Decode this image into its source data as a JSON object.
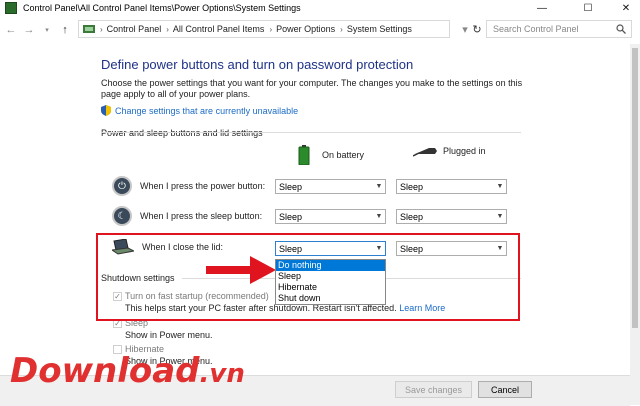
{
  "window": {
    "title": "Control Panel\\All Control Panel Items\\Power Options\\System Settings",
    "controls": {
      "minimize": "—",
      "maximize": "☐",
      "close": "✕"
    }
  },
  "address_bar": {
    "crumbs": [
      "Control Panel",
      "All Control Panel Items",
      "Power Options",
      "System Settings"
    ],
    "search_placeholder": "Search Control Panel"
  },
  "page": {
    "heading": "Define power buttons and turn on password protection",
    "description": "Choose the power settings that you want for your computer. The changes you make to the settings on this page apply to all of your power plans.",
    "change_link": "Change settings that are currently unavailable",
    "section_title": "Power and sleep buttons and lid settings",
    "columns": {
      "battery": "On battery",
      "plugged": "Plugged in"
    },
    "rows": [
      {
        "label": "When I press the power button:",
        "battery": "Sleep",
        "plugged": "Sleep"
      },
      {
        "label": "When I press the sleep button:",
        "battery": "Sleep",
        "plugged": "Sleep"
      },
      {
        "label": "When I close the lid:",
        "battery": "Sleep",
        "plugged": "Sleep"
      }
    ],
    "dropdown_options": [
      "Do nothing",
      "Sleep",
      "Hibernate",
      "Shut down"
    ],
    "dropdown_highlighted": "Do nothing",
    "shutdown": {
      "title": "Shutdown settings",
      "fast_startup": "Turn on fast startup (recommended)",
      "fast_startup_desc": "This helps start your PC faster after shutdown. Restart isn't affected.",
      "learn_more": "Learn More",
      "sleep": "Sleep",
      "sleep_desc": "Show in Power menu.",
      "hibernate": "Hibernate",
      "hibernate_desc": "Show in Power menu."
    }
  },
  "footer": {
    "save": "Save changes",
    "cancel": "Cancel"
  },
  "watermark": {
    "main": "Download",
    "suffix": ".vn"
  },
  "colors": {
    "accent": "#0078d7",
    "heading": "#1e3287",
    "link": "#1c6cc7",
    "highlight_border": "#e0141e"
  }
}
